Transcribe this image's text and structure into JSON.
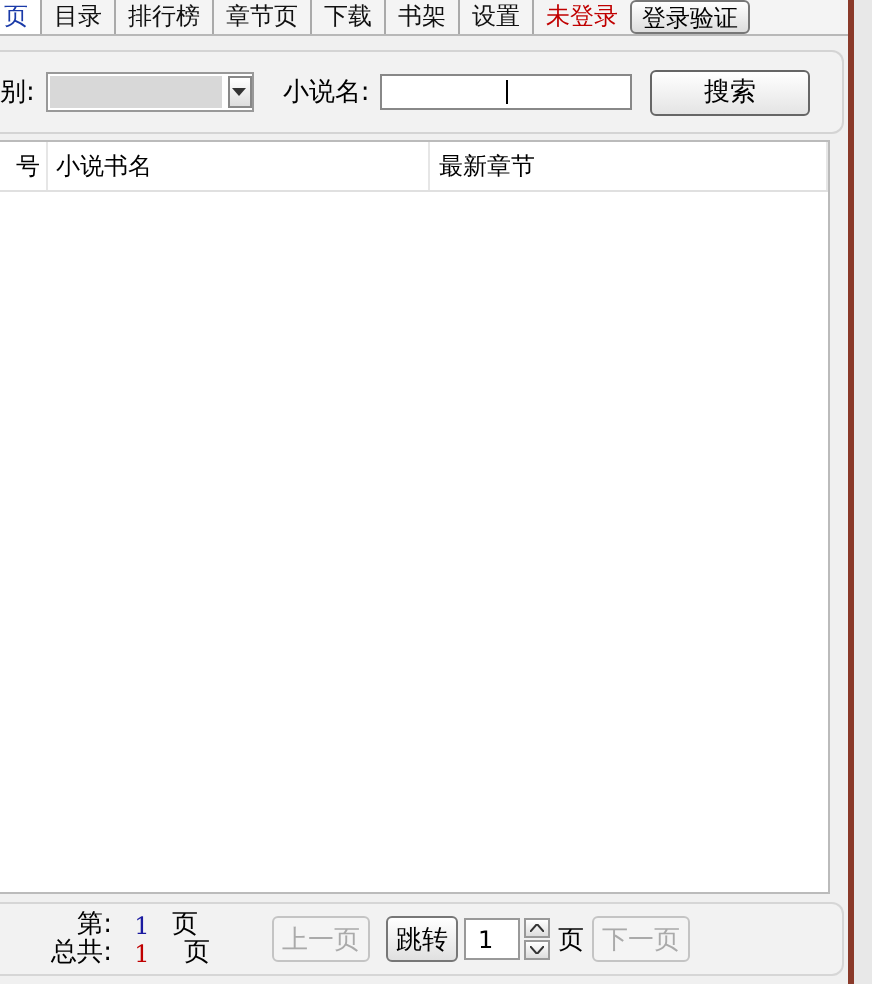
{
  "tabs": [
    {
      "label": "页",
      "selected": true
    },
    {
      "label": "目录",
      "selected": false
    },
    {
      "label": "排行榜",
      "selected": false
    },
    {
      "label": "章节页",
      "selected": false
    },
    {
      "label": "下载",
      "selected": false
    },
    {
      "label": "书架",
      "selected": false
    },
    {
      "label": "设置",
      "selected": false
    }
  ],
  "login_status": "未登录",
  "login_button": "登录验证",
  "search": {
    "category_label": "别:",
    "category_disabled": true,
    "name_label": "小说名:",
    "button": "搜索"
  },
  "table": {
    "columns": [
      "号",
      "小说书名",
      "最新章节"
    ]
  },
  "pager": {
    "current_label": "第:",
    "current_page": "1",
    "current_unit": "页",
    "total_label": "总共:",
    "total_pages": "1",
    "total_unit": "页",
    "prev_button": {
      "label": "上一页",
      "disabled": true
    },
    "jump_button": "跳转",
    "page_input": "1",
    "page_unit": "页",
    "next_button": {
      "label": "下一页",
      "disabled": true
    }
  }
}
